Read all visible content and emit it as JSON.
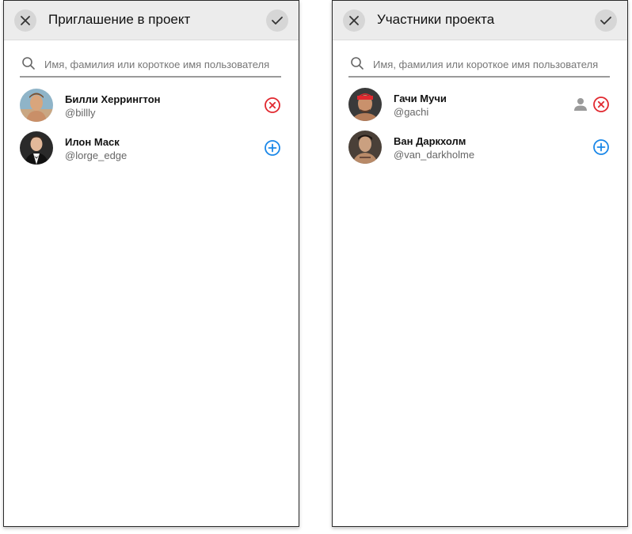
{
  "left_panel": {
    "title": "Приглашение в проект",
    "search_placeholder": "Имя, фамилия или короткое имя пользователя",
    "users": [
      {
        "name": "Билли Херрингтон",
        "handle": "@billly",
        "action": "remove"
      },
      {
        "name": "Илон Маск",
        "handle": "@lorge_edge",
        "action": "add"
      }
    ]
  },
  "right_panel": {
    "title": "Участники проекта",
    "search_placeholder": "Имя, фамилия или короткое имя пользователя",
    "users": [
      {
        "name": "Гачи Мучи",
        "handle": "@gachi",
        "action": "remove",
        "has_role_icon": true
      },
      {
        "name": "Ван Даркхолм",
        "handle": "@van_darkholme",
        "action": "add"
      }
    ]
  },
  "colors": {
    "remove": "#e1282f",
    "add": "#1a87e8",
    "header_bg": "#ececec",
    "header_button_bg": "#d6d6d6"
  },
  "icons": {
    "close": "close-icon",
    "confirm": "check-icon",
    "search": "search-icon",
    "remove": "remove-circle-icon",
    "add": "add-circle-icon",
    "role": "person-icon"
  }
}
